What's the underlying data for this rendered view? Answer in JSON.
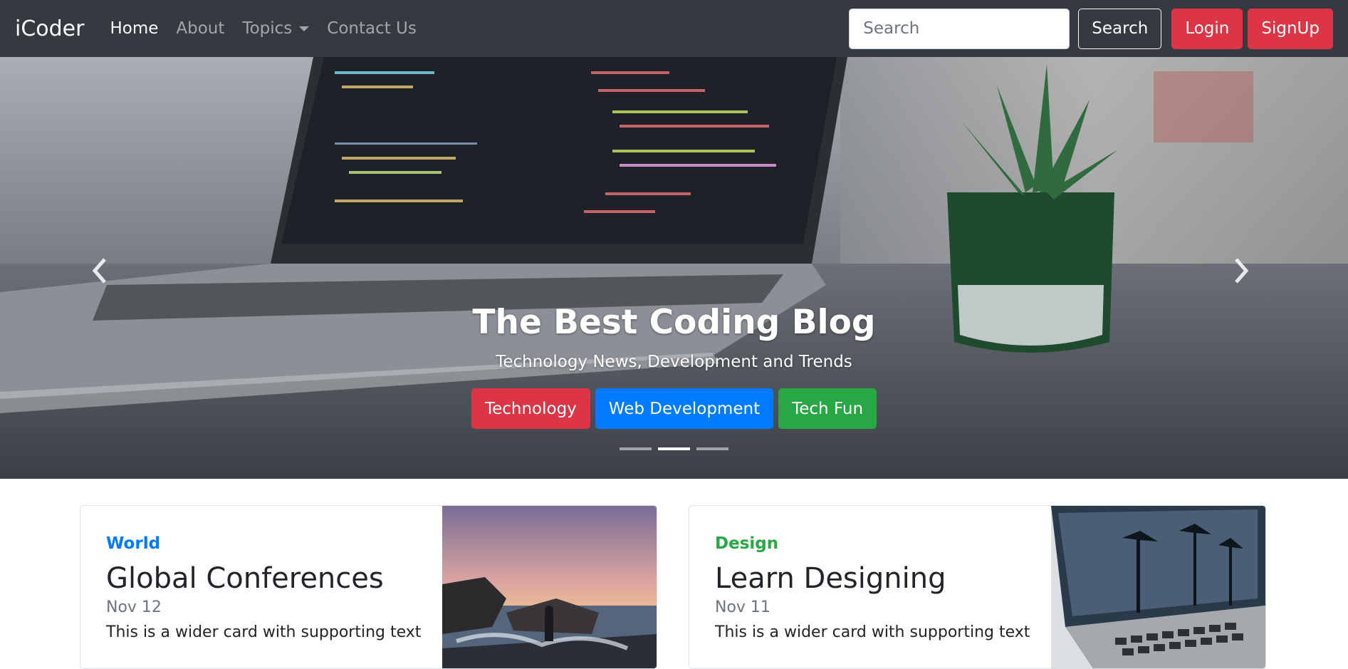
{
  "navbar": {
    "brand": "iCoder",
    "links": [
      {
        "label": "Home",
        "active": true
      },
      {
        "label": "About",
        "active": false
      },
      {
        "label": "Topics",
        "active": false,
        "dropdown": true
      },
      {
        "label": "Contact Us",
        "active": false
      }
    ],
    "search": {
      "placeholder": "Search",
      "value": ""
    },
    "search_button": "Search",
    "login_button": "Login",
    "signup_button": "SignUp"
  },
  "carousel": {
    "title": "The Best Coding Blog",
    "subtitle": "Technology News, Development and Trends",
    "buttons": [
      {
        "label": "Technology",
        "color": "#dc3545"
      },
      {
        "label": "Web Development",
        "color": "#007bff"
      },
      {
        "label": "Tech Fun",
        "color": "#28a745"
      }
    ],
    "indicator_count": 3,
    "active_indicator": 2,
    "prev_icon": "chevron-left-icon",
    "next_icon": "chevron-right-icon"
  },
  "cards": [
    {
      "category": "World",
      "category_color": "#007bff",
      "title": "Global Conferences",
      "date": "Nov 12",
      "text": "This is a wider card with supporting text"
    },
    {
      "category": "Design",
      "category_color": "#28a745",
      "title": "Learn Designing",
      "date": "Nov 11",
      "text": "This is a wider card with supporting text"
    }
  ],
  "colors": {
    "navbar_bg": "#343a40",
    "danger": "#dc3545",
    "primary": "#007bff",
    "success": "#28a745"
  }
}
